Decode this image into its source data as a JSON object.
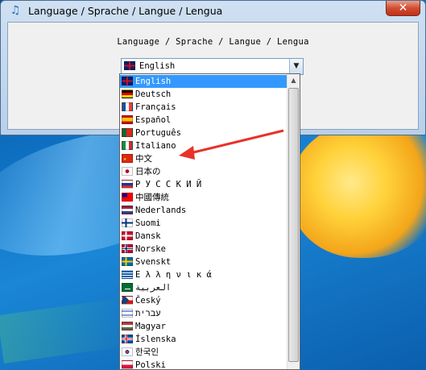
{
  "window": {
    "title": "Language / Sprache  / Langue / Lengua",
    "close_label": "✕"
  },
  "dialog": {
    "prompt": "Language / Sprache  / Langue / Lengua"
  },
  "combo": {
    "selected_value": "English",
    "arrow_glyph": "▼"
  },
  "dropdown": {
    "scroll_up_glyph": "▲",
    "items": [
      {
        "label": "English",
        "flag": "uk-flag-icon",
        "selected": true
      },
      {
        "label": "Deutsch",
        "flag": "germany-flag-icon"
      },
      {
        "label": "Français",
        "flag": "france-flag-icon"
      },
      {
        "label": "Español",
        "flag": "spain-flag-icon"
      },
      {
        "label": "Português",
        "flag": "portugal-flag-icon"
      },
      {
        "label": "Italiano",
        "flag": "italy-flag-icon"
      },
      {
        "label": "中文",
        "flag": "china-flag-icon"
      },
      {
        "label": "日本の",
        "flag": "japan-flag-icon"
      },
      {
        "label": "Р У С С К И Й",
        "flag": "russia-flag-icon"
      },
      {
        "label": "中國傳統",
        "flag": "taiwan-flag-icon"
      },
      {
        "label": "Nederlands",
        "flag": "netherlands-flag-icon"
      },
      {
        "label": "Suomi",
        "flag": "finland-flag-icon"
      },
      {
        "label": "Dansk",
        "flag": "denmark-flag-icon"
      },
      {
        "label": "Norske",
        "flag": "norway-flag-icon"
      },
      {
        "label": "Svenskt",
        "flag": "sweden-flag-icon"
      },
      {
        "label": "Ε λ λ η ν ι κ ά",
        "flag": "greece-flag-icon"
      },
      {
        "label": "العربية",
        "flag": "saudi-flag-icon"
      },
      {
        "label": "Český",
        "flag": "czech-flag-icon"
      },
      {
        "label": "עברית",
        "flag": "israel-flag-icon"
      },
      {
        "label": "Magyar",
        "flag": "hungary-flag-icon"
      },
      {
        "label": "Íslenska",
        "flag": "iceland-flag-icon"
      },
      {
        "label": "한국인",
        "flag": "korea-flag-icon"
      },
      {
        "label": "Polski",
        "flag": "poland-flag-icon"
      }
    ]
  },
  "annotation": {
    "arrow_color": "#e8322a"
  }
}
